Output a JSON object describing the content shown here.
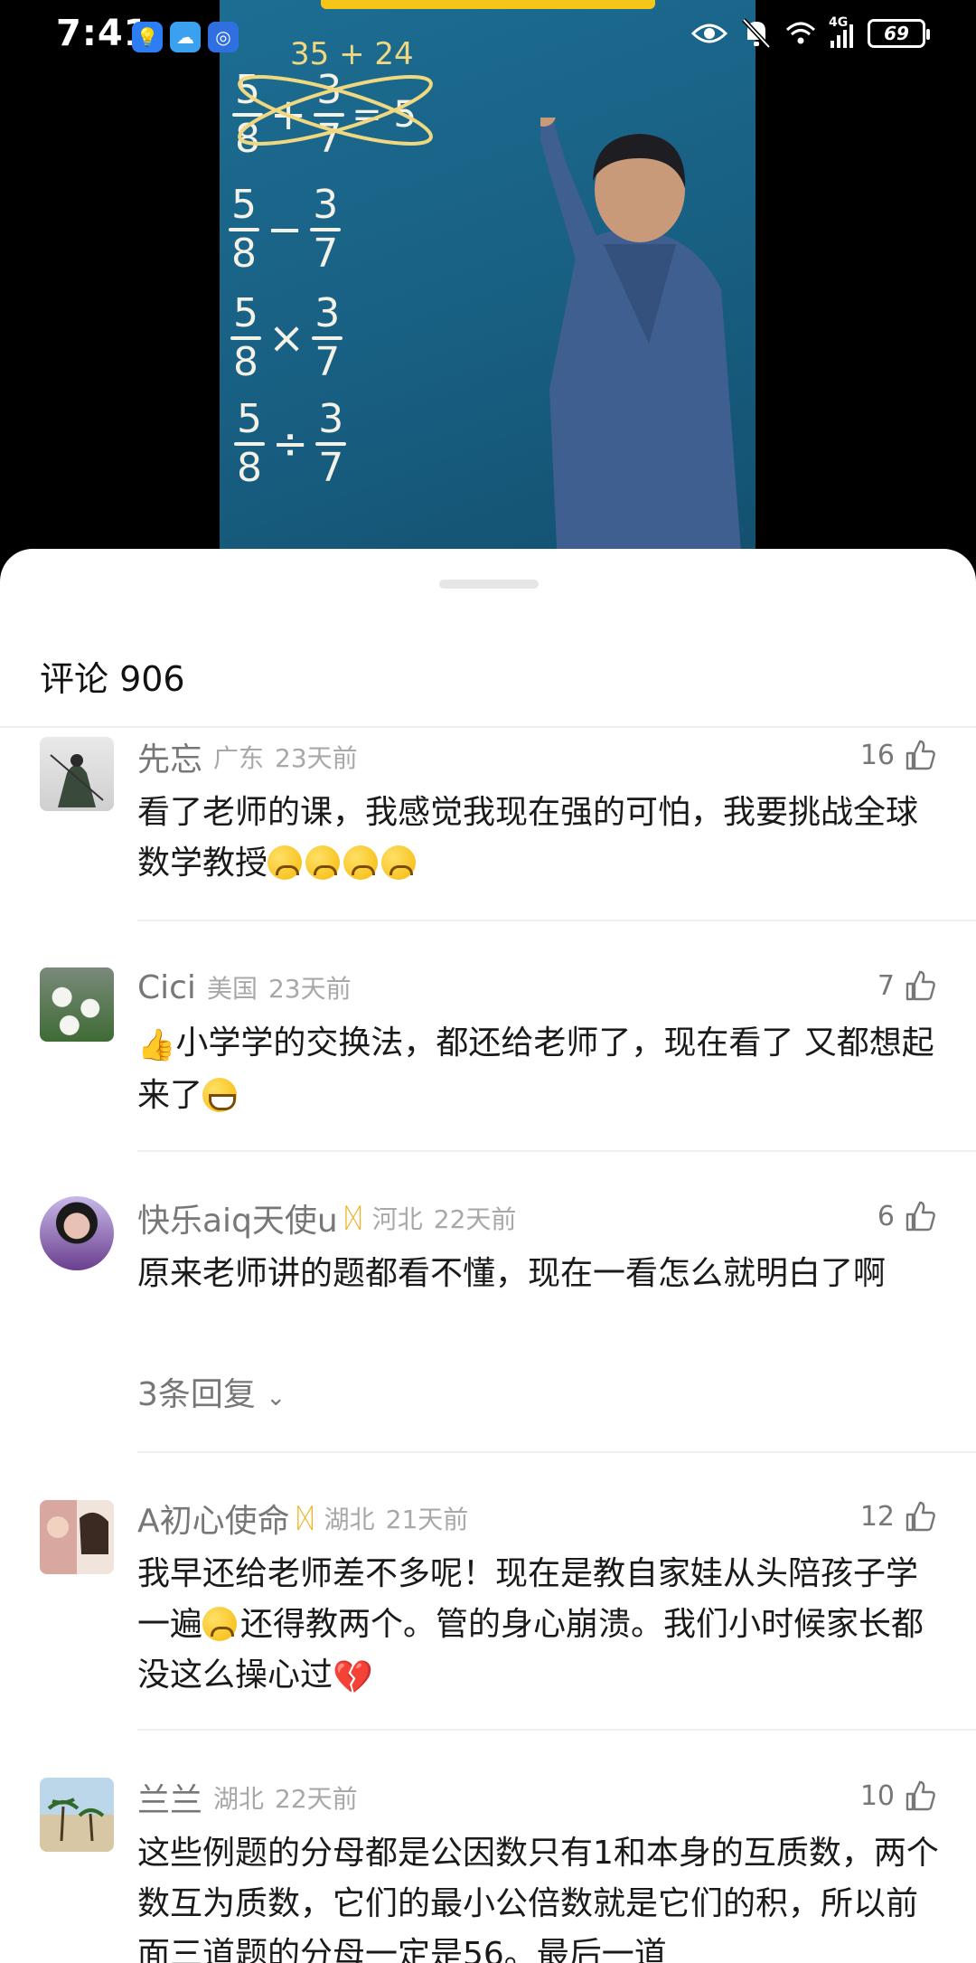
{
  "status_bar": {
    "time": "7:41",
    "network": "4G",
    "battery": "69",
    "icons": [
      "bulb-app-icon",
      "weather-app-icon",
      "browser-app-icon",
      "eye-icon",
      "bell-muted-icon",
      "wifi-icon",
      "signal-icon"
    ]
  },
  "video": {
    "top_sum": "35 + 24",
    "rows": [
      {
        "a_num": "5",
        "a_den": "8",
        "op": "+",
        "b_num": "3",
        "b_den": "7",
        "tail": "= 5"
      },
      {
        "a_num": "5",
        "a_den": "8",
        "op": "−",
        "b_num": "3",
        "b_den": "7"
      },
      {
        "a_num": "5",
        "a_den": "8",
        "op": "×",
        "b_num": "3",
        "b_den": "7"
      },
      {
        "a_num": "5",
        "a_den": "8",
        "op": "÷",
        "b_num": "3",
        "b_den": "7"
      }
    ]
  },
  "sheet": {
    "title": "评论 906"
  },
  "comments": [
    {
      "name": "先忘",
      "location": "广东",
      "time": "23天前",
      "likes": "16",
      "text": "看了老师的课，我感觉我现在强的可怕，我要挑战全球数学教授"
    },
    {
      "name": "Cici",
      "location": "美国",
      "time": "23天前",
      "likes": "7",
      "text": "小学学的交换法，都还给老师了，现在看了 又都想起来了"
    },
    {
      "name": "快乐aiq天使u",
      "location": "河北",
      "time": "22天前",
      "likes": "6",
      "text": "原来老师讲的题都看不懂，现在一看怎么就明白了啊",
      "replies": "3条回复"
    },
    {
      "name": "A初心使命",
      "location": "湖北",
      "time": "21天前",
      "likes": "12",
      "text_a": "我早还给老师差不多呢！现在是教自家娃从头陪孩子学一遍",
      "text_b": "还得教两个。管的身心崩溃。我们小时候家长都没这么操心过"
    },
    {
      "name": "兰兰",
      "location": "湖北",
      "time": "22天前",
      "likes": "10",
      "text": "这些例题的分母都是公因数只有1和本身的互质数，两个数互为质数，它们的最小公倍数就是它们的积，所以前面三道题的分母一定是56。最后一道"
    }
  ]
}
